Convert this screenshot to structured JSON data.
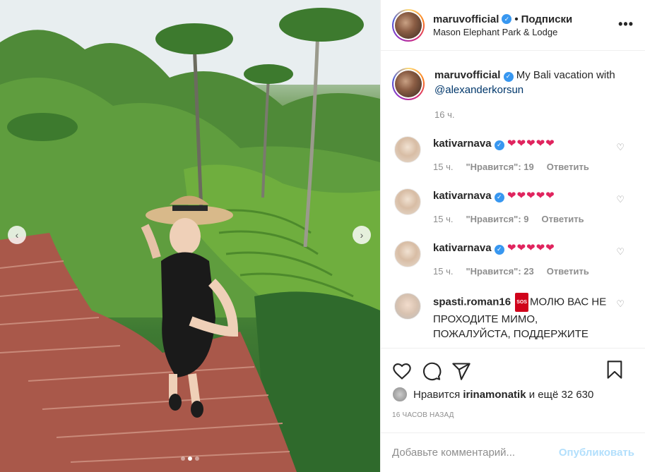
{
  "post": {
    "author": "maruvofficial",
    "follow_label": "Подписки",
    "separator": "•",
    "location": "Mason Elephant Park & Lodge",
    "more_label": "•••",
    "caption_text": "My Bali vacation with",
    "caption_mention": "@alexanderkorsun",
    "caption_time": "16 ч.",
    "verified_mark": "✓"
  },
  "photo": {
    "prev_label": "‹",
    "next_label": "›",
    "carousel_dots": 3,
    "active_dot": 2
  },
  "comments": [
    {
      "user": "kativarnava",
      "text": "❤❤❤❤❤",
      "time": "15 ч.",
      "likes": "\"Нравится\": 19",
      "reply": "Ответить"
    },
    {
      "user": "kativarnava",
      "text": "❤❤❤❤❤",
      "time": "15 ч.",
      "likes": "\"Нравится\": 9",
      "reply": "Ответить"
    },
    {
      "user": "kativarnava",
      "text": "❤❤❤❤❤",
      "time": "15 ч.",
      "likes": "\"Нравится\": 23",
      "reply": "Ответить"
    },
    {
      "user": "spasti.roman16",
      "sos": "SOS",
      "text": "МОЛЮ ВАС НЕ ПРОХОДИТЕ МИМО, ПОЖАЛУЙСТА, ПОДДЕРЖИТЕ"
    }
  ],
  "likes": {
    "prefix": "Нравится",
    "user": "irinamonatik",
    "suffix": "и ещё 32 630"
  },
  "timestamp": "16 ЧАСОВ НАЗАД",
  "add_comment": {
    "placeholder": "Добавьте комментарий...",
    "publish_label": "Опубликовать"
  },
  "icons": {
    "like": "heart-icon",
    "comment": "comment-icon",
    "share": "share-icon",
    "save": "bookmark-icon"
  },
  "colors": {
    "accent": "#3897f0",
    "heart": "#e0245e",
    "publish_disabled": "#b2dffc",
    "muted": "#8e8e8e"
  }
}
